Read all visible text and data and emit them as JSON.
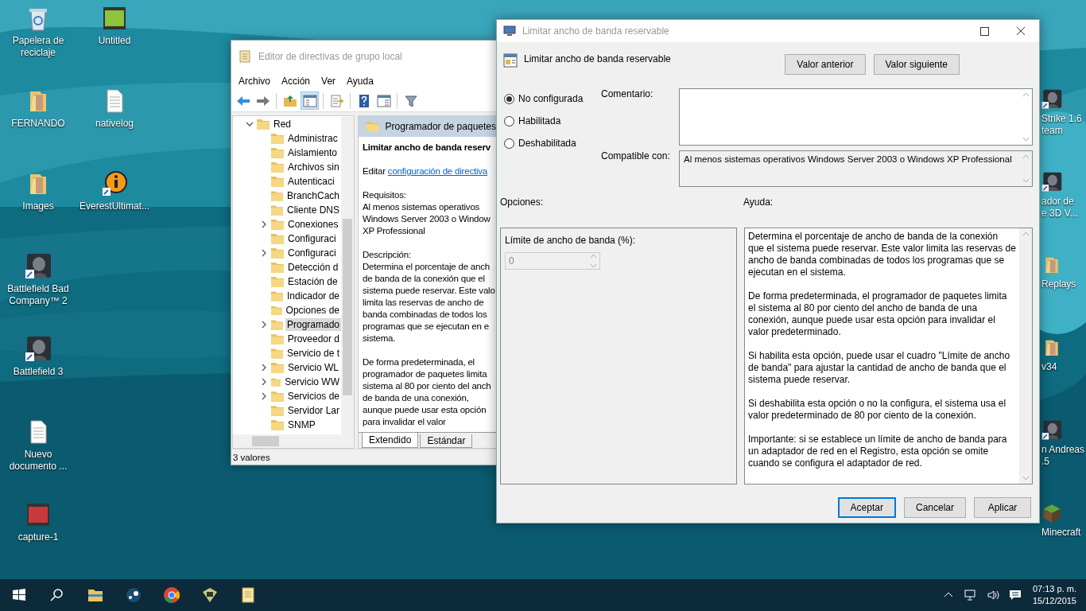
{
  "desktop": {
    "icons_left": [
      {
        "kind": "recycle",
        "label": [
          "Papelera de",
          "reciclaje"
        ]
      },
      {
        "kind": "video",
        "label": [
          "Untitled"
        ]
      },
      {
        "kind": "folder",
        "label": [
          "FERNANDO"
        ]
      },
      {
        "kind": "document",
        "label": [
          "nativelog"
        ]
      },
      {
        "kind": "folder",
        "label": [
          "Images"
        ]
      },
      {
        "kind": "info",
        "label": [
          "EverestUltimat..."
        ]
      },
      {
        "kind": "game",
        "label": [
          "Battlefield Bad",
          "Company™ 2"
        ]
      },
      {
        "kind": "empty"
      },
      {
        "kind": "game",
        "label": [
          "Battlefield 3"
        ]
      },
      {
        "kind": "empty"
      },
      {
        "kind": "document",
        "label": [
          "Nuevo",
          "documento ..."
        ]
      },
      {
        "kind": "empty"
      },
      {
        "kind": "videored",
        "label": [
          "capture-1"
        ]
      }
    ],
    "icons_right": [
      {
        "kind": "game",
        "label": [
          "Strike 1.6",
          "team"
        ]
      },
      {
        "kind": "game",
        "label": [
          "ador de",
          "e 3D V..."
        ]
      },
      {
        "kind": "folder",
        "label": [
          "Replays"
        ]
      },
      {
        "kind": "folder",
        "label": [
          "v34"
        ]
      },
      {
        "kind": "game",
        "label": [
          "n Andreas",
          ".5"
        ]
      },
      {
        "kind": "block",
        "label": [
          "Minecraft"
        ]
      }
    ]
  },
  "gpedit": {
    "title": "Editor de directivas de grupo local",
    "menu": [
      "Archivo",
      "Acción",
      "Ver",
      "Ayuda"
    ],
    "toolbar": [
      {
        "kind": "back",
        "pressed": false
      },
      {
        "kind": "forward",
        "pressed": false
      },
      {
        "kind": "sep"
      },
      {
        "kind": "folderup",
        "pressed": false
      },
      {
        "kind": "tree",
        "pressed": true
      },
      {
        "kind": "sep"
      },
      {
        "kind": "export",
        "pressed": false
      },
      {
        "kind": "sep"
      },
      {
        "kind": "help",
        "pressed": false
      },
      {
        "kind": "view",
        "pressed": false
      },
      {
        "kind": "sep"
      },
      {
        "kind": "filter",
        "pressed": false
      }
    ],
    "tree": {
      "label": "Red",
      "expanded": true,
      "selected": false,
      "children": [
        {
          "label": "Administrac",
          "selected": false
        },
        {
          "label": "Aislamiento",
          "selected": false
        },
        {
          "label": "Archivos sin",
          "selected": false
        },
        {
          "label": "Autenticaci",
          "selected": false
        },
        {
          "label": "BranchCach",
          "selected": false
        },
        {
          "label": "Cliente DNS",
          "selected": false
        },
        {
          "label": "Conexiones",
          "selected": false,
          "expanded": false
        },
        {
          "label": "Configuraci",
          "selected": false
        },
        {
          "label": "Configuraci",
          "selected": false,
          "expanded": false
        },
        {
          "label": "Detección d",
          "selected": false
        },
        {
          "label": "Estación de",
          "selected": false
        },
        {
          "label": "Indicador de",
          "selected": false
        },
        {
          "label": "Opciones de",
          "selected": false
        },
        {
          "label": "Programado",
          "selected": true,
          "expanded": false
        },
        {
          "label": "Proveedor d",
          "selected": false
        },
        {
          "label": "Servicio de t",
          "selected": false
        },
        {
          "label": "Servicio WL",
          "selected": false,
          "expanded": false
        },
        {
          "label": "Servicio WW",
          "selected": false,
          "expanded": false
        },
        {
          "label": "Servicios de",
          "selected": false,
          "expanded": false
        },
        {
          "label": "Servidor Lar",
          "selected": false
        },
        {
          "label": "SNMP",
          "selected": false
        }
      ]
    },
    "detail": {
      "header": "Programador de paquetes",
      "policy_title": "Limitar ancho de banda reserv",
      "edit_prefix": "Editar",
      "edit_link": "configuración de directiva",
      "paragraphs": [
        [
          "Requisitos:",
          "Al menos sistemas operativos",
          "Windows Server 2003 o Window",
          "XP Professional"
        ],
        [
          "Descripción:",
          "Determina el porcentaje de anch",
          "de banda de la conexión que el",
          "sistema puede reservar. Este valo",
          "limita las reservas de ancho de",
          "banda combinadas de todos los",
          "programas que se ejecutan en e",
          "sistema."
        ],
        [
          "De forma predeterminada, el",
          "programador de paquetes limita",
          "sistema al 80 por ciento del anch",
          "de banda de una conexión,",
          "aunque puede usar esta opción",
          "para invalidar el valor"
        ]
      ]
    },
    "tabs": [
      {
        "label": "Extendido",
        "selected": true
      },
      {
        "label": "Estándar",
        "selected": false
      }
    ],
    "status_bar": "3 valores"
  },
  "dialog": {
    "title": "Limitar ancho de banda reservable",
    "heading": "Limitar ancho de banda reservable",
    "nav_buttons": [
      "Valor anterior",
      "Valor siguiente"
    ],
    "states": [
      {
        "label": "No configurada",
        "selected": true
      },
      {
        "label": "Habilitada",
        "selected": false
      },
      {
        "label": "Deshabilitada",
        "selected": false
      }
    ],
    "comment_label": "Comentario:",
    "compatible_label": "Compatible con:",
    "compatible_text": "Al menos sistemas operativos Windows Server 2003 o Windows XP Professional",
    "options_label": "Opciones:",
    "help_label": "Ayuda:",
    "option": {
      "label": "Límite de ancho de banda (%):",
      "value": "0",
      "disabled": true
    },
    "help": [
      "Determina el porcentaje de ancho de banda de la conexión que el sistema puede reservar. Este valor limita las reservas de ancho de banda combinadas de todos los programas que se ejecutan en el sistema.",
      "De forma predeterminada, el programador de paquetes limita el sistema al 80 por ciento del ancho de banda de una conexión, aunque puede usar esta opción para invalidar el valor predeterminado.",
      "Si habilita esta opción, puede usar el cuadro \"Límite de ancho de banda\" para ajustar la cantidad de ancho de banda que el sistema puede reservar.",
      "Si deshabilita esta opción o no la configura, el sistema usa el valor predeterminado de 80 por ciento de la conexión.",
      "Importante: si se establece un límite de ancho de banda para un adaptador de red en el Registro, esta opción se omite cuando se configura el adaptador de red."
    ],
    "buttons": [
      {
        "label": "Aceptar",
        "default": true
      },
      {
        "label": "Cancelar",
        "default": false
      },
      {
        "label": "Aplicar",
        "default": false
      }
    ]
  },
  "taskbar": {
    "apps": [
      {
        "kind": "start"
      },
      {
        "kind": "search"
      },
      {
        "kind": "explorer"
      },
      {
        "kind": "steam"
      },
      {
        "kind": "chrome"
      },
      {
        "kind": "app"
      },
      {
        "kind": "notes"
      }
    ],
    "tray": [
      {
        "kind": "chevron"
      },
      {
        "kind": "network"
      },
      {
        "kind": "volume"
      },
      {
        "kind": "notification"
      }
    ],
    "time": "07:13 p. m.",
    "date": "15/12/2015"
  }
}
